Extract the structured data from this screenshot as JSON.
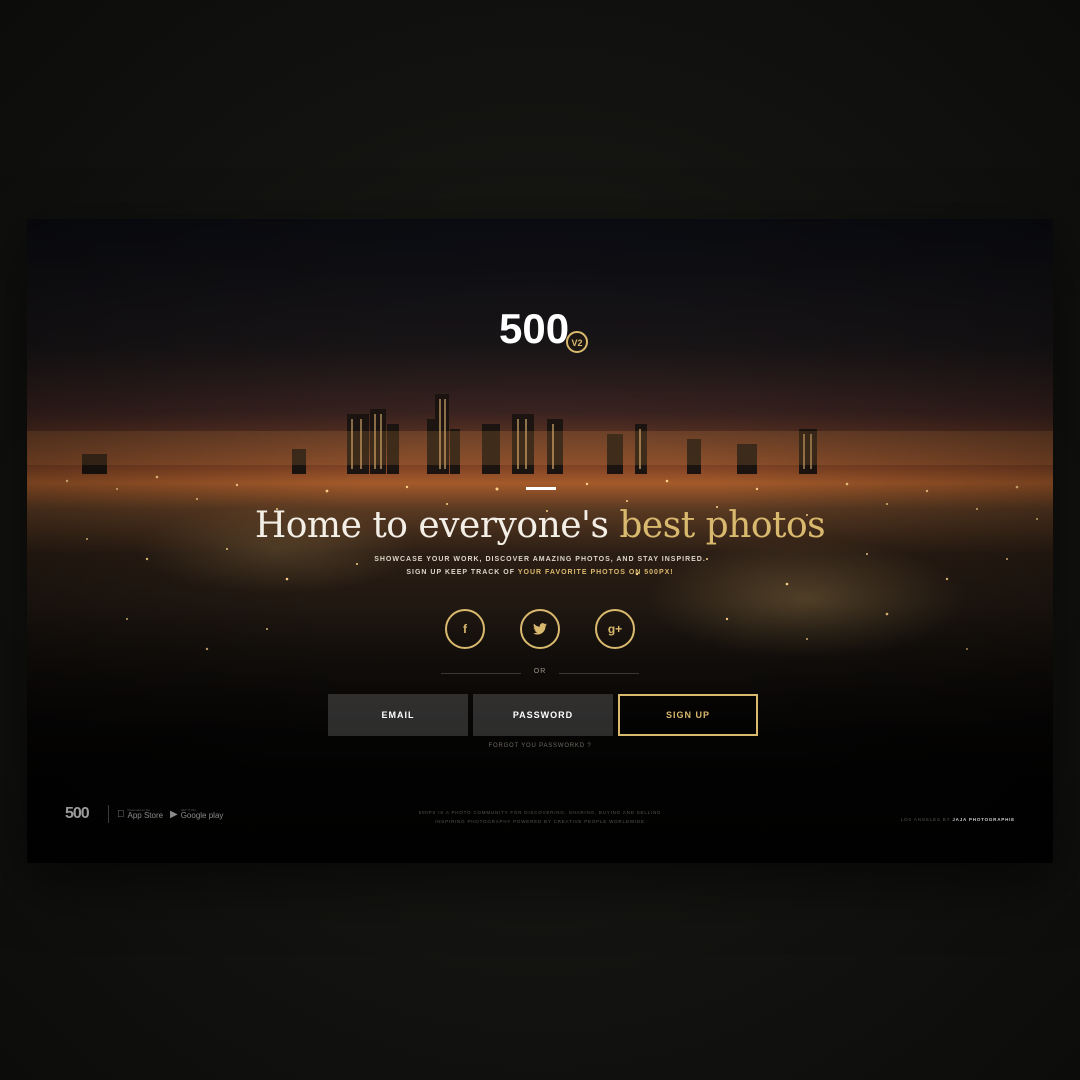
{
  "brand": {
    "logo_text": "500",
    "version_badge": "V2"
  },
  "hero": {
    "headline_main": "Home to everyone's ",
    "headline_accent": "best photos",
    "sub_line1": "SHOWCASE YOUR WORK, DISCOVER AMAZING PHOTOS, AND STAY INSPIRED.",
    "sub_line2_prefix": "SIGN UP KEEP TRACK OF ",
    "sub_line2_accent": "YOUR FAVORITE PHOTOS ON 500PX!"
  },
  "social": {
    "facebook_glyph": "f",
    "twitter_glyph": "t",
    "google_glyph": "g+",
    "or_label": "OR"
  },
  "form": {
    "email_label": "EMAIL",
    "password_label": "PASSWORD",
    "signup_label": "SIGN UP",
    "forgot_label": "FORGOT YOU PASSWORKD ?"
  },
  "footer": {
    "logo_text": "500",
    "apple_small": "Download on the",
    "apple_big": "App Store",
    "google_small": "GET IT ON",
    "google_big": "Google play",
    "about_line1": "500PX IS A PHOTO COMMUNITY FOR DISCOVERING, SHARING, BUYING AND SELLING",
    "about_line2": "INSPIRING PHOTOGRAPHY POWERED BY CREATIVE PEOPLE WORLDWIDE",
    "credit_prefix": "LOS ANGELES BY ",
    "credit_name": "JAJA PHOTOGRAPHIE"
  },
  "colors": {
    "accent": "#d9b96e",
    "text_light": "#f4efe6",
    "field_bg": "rgba(120,120,120,0.35)"
  }
}
